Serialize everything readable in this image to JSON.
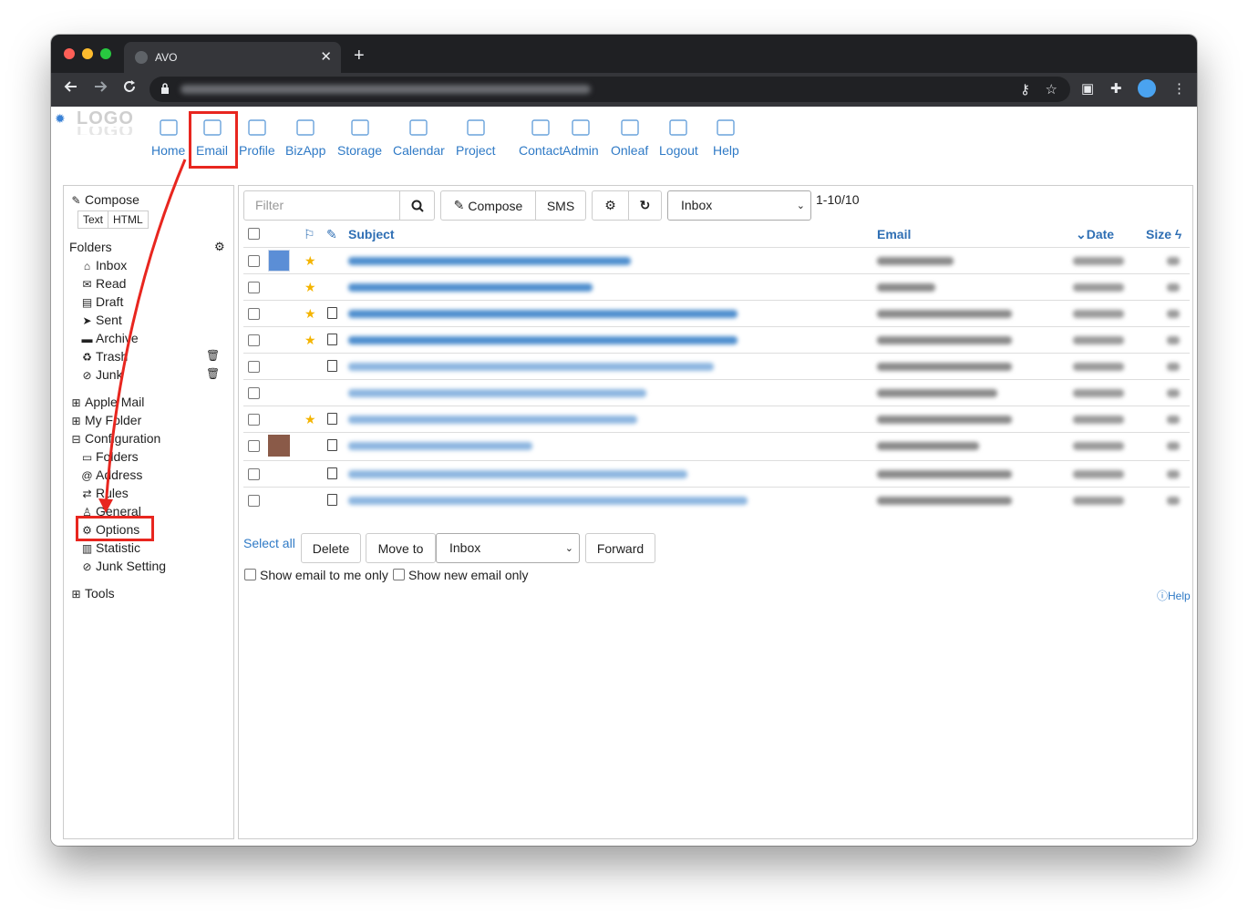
{
  "browser": {
    "tab_title": "AVO",
    "tab_close": "✕",
    "new_tab": "+"
  },
  "logo": {
    "line1": "LOGO",
    "line2": "LOGO"
  },
  "nav": [
    {
      "label": "Home",
      "icon": "home-icon"
    },
    {
      "label": "Email",
      "icon": "email-icon"
    },
    {
      "label": "Profile",
      "icon": "profile-icon"
    },
    {
      "label": "BizApp",
      "icon": "bizapp-icon"
    },
    {
      "label": "Storage",
      "icon": "storage-icon"
    },
    {
      "label": "Calendar",
      "icon": "calendar-icon"
    },
    {
      "label": "Project",
      "icon": "project-icon"
    },
    {
      "label": "Contact",
      "icon": "contact-icon"
    },
    {
      "label": "Admin",
      "icon": "admin-icon"
    },
    {
      "label": "Onleaf",
      "icon": "onleaf-icon"
    },
    {
      "label": "Logout",
      "icon": "logout-icon"
    },
    {
      "label": "Help",
      "icon": "help-icon"
    }
  ],
  "sidebar": {
    "compose": "Compose",
    "text": "Text",
    "html": "HTML",
    "folders_title": "Folders",
    "folders": [
      "Inbox",
      "Read",
      "Draft",
      "Sent",
      "Archive",
      "Trash",
      "Junk"
    ],
    "groups": [
      "Apple Mail",
      "My Folder",
      "Configuration"
    ],
    "config_items": [
      "Folders",
      "Address",
      "Rules",
      "General",
      "Options",
      "Statistic",
      "Junk Setting"
    ],
    "tools": "Tools"
  },
  "main": {
    "filter_placeholder": "Filter",
    "compose": "Compose",
    "sms": "SMS",
    "folder_select": "Inbox",
    "count": "1-10/10",
    "col_subject": "Subject",
    "col_email": "Email",
    "col_date": "Date",
    "col_size": "Size",
    "select_all": "Select all",
    "delete": "Delete",
    "move_to": "Move to",
    "move_target": "Inbox",
    "forward": "Forward",
    "show_to_me": "Show email to me only",
    "show_new": "Show new email only",
    "help": "Help"
  },
  "colors": {
    "accent": "#2f7ac6",
    "highlight": "#e8261f",
    "star": "#f4b400"
  }
}
